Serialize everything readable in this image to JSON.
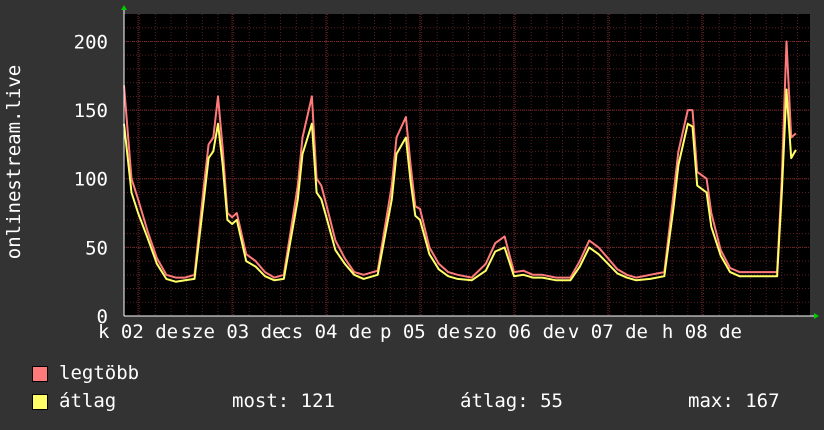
{
  "colors": {
    "background": "#333333",
    "plot_background": "#000000",
    "grid": "#5a2020",
    "grid_major": "#7a2a2a",
    "axis": "#ffffff",
    "arrow": "#00cc00",
    "max_series": "#ff7b7b",
    "avg_series": "#ffff66"
  },
  "chart_data": {
    "type": "line",
    "ylabel": "onlinestream.live",
    "ylim": [
      0,
      220
    ],
    "yticks": [
      "0",
      "50",
      "100",
      "150",
      "200"
    ],
    "ytick_values": [
      0,
      50,
      100,
      150,
      200
    ],
    "x_days": 7.3,
    "xticks": [
      "k 02 de",
      "sze 03 de",
      "cs 04 de",
      "p 05 de",
      "szo 06 de",
      "v 07 de",
      "h 08 de"
    ],
    "xtick_positions": [
      0.15,
      1.15,
      2.15,
      3.15,
      4.15,
      5.15,
      6.15
    ],
    "legend": [
      "legtöbb",
      "átlag"
    ],
    "series": [
      {
        "name": "legtöbb",
        "color": "#ff7b7b",
        "x": [
          0,
          0.08,
          0.15,
          0.25,
          0.35,
          0.45,
          0.55,
          0.65,
          0.75,
          0.85,
          0.9,
          0.95,
          1.0,
          1.05,
          1.1,
          1.15,
          1.2,
          1.3,
          1.4,
          1.5,
          1.6,
          1.7,
          1.85,
          1.9,
          2.0,
          2.05,
          2.1,
          2.15,
          2.25,
          2.35,
          2.45,
          2.55,
          2.7,
          2.85,
          2.9,
          3.0,
          3.05,
          3.1,
          3.15,
          3.25,
          3.35,
          3.45,
          3.55,
          3.7,
          3.85,
          3.95,
          4.05,
          4.15,
          4.25,
          4.35,
          4.45,
          4.6,
          4.75,
          4.85,
          4.95,
          5.05,
          5.15,
          5.25,
          5.35,
          5.45,
          5.6,
          5.75,
          5.85,
          5.9,
          6.0,
          6.05,
          6.1,
          6.2,
          6.25,
          6.35,
          6.45,
          6.55,
          6.75,
          6.95,
          7.0,
          7.05,
          7.1,
          7.15
        ],
        "values": [
          168,
          100,
          85,
          62,
          42,
          30,
          28,
          28,
          30,
          95,
          125,
          130,
          160,
          122,
          75,
          72,
          75,
          45,
          40,
          32,
          28,
          30,
          95,
          130,
          160,
          100,
          95,
          82,
          55,
          42,
          32,
          30,
          33,
          95,
          130,
          145,
          110,
          80,
          78,
          50,
          38,
          32,
          30,
          28,
          38,
          53,
          58,
          32,
          33,
          30,
          30,
          28,
          28,
          40,
          55,
          50,
          42,
          34,
          30,
          28,
          30,
          32,
          90,
          120,
          150,
          150,
          105,
          100,
          75,
          48,
          35,
          32,
          32,
          32,
          100,
          200,
          130,
          133
        ]
      },
      {
        "name": "átlag",
        "color": "#ffff66",
        "x": [
          0,
          0.08,
          0.15,
          0.25,
          0.35,
          0.45,
          0.55,
          0.65,
          0.75,
          0.85,
          0.9,
          0.95,
          1.0,
          1.05,
          1.1,
          1.15,
          1.2,
          1.3,
          1.4,
          1.5,
          1.6,
          1.7,
          1.85,
          1.9,
          2.0,
          2.05,
          2.1,
          2.15,
          2.25,
          2.35,
          2.45,
          2.55,
          2.7,
          2.85,
          2.9,
          3.0,
          3.05,
          3.1,
          3.15,
          3.25,
          3.35,
          3.45,
          3.55,
          3.7,
          3.85,
          3.95,
          4.05,
          4.15,
          4.25,
          4.35,
          4.45,
          4.6,
          4.75,
          4.85,
          4.95,
          5.05,
          5.15,
          5.25,
          5.35,
          5.45,
          5.6,
          5.75,
          5.85,
          5.9,
          6.0,
          6.05,
          6.1,
          6.2,
          6.25,
          6.35,
          6.45,
          6.55,
          6.75,
          6.95,
          7.0,
          7.05,
          7.1,
          7.15
        ],
        "values": [
          140,
          90,
          75,
          57,
          38,
          27,
          25,
          26,
          27,
          85,
          115,
          120,
          140,
          110,
          70,
          67,
          70,
          40,
          36,
          29,
          26,
          27,
          85,
          118,
          140,
          90,
          85,
          73,
          48,
          38,
          30,
          27,
          30,
          85,
          118,
          130,
          98,
          73,
          70,
          45,
          34,
          29,
          27,
          26,
          33,
          47,
          50,
          29,
          30,
          28,
          28,
          26,
          26,
          36,
          50,
          45,
          38,
          31,
          28,
          26,
          27,
          29,
          80,
          110,
          140,
          138,
          95,
          90,
          65,
          44,
          32,
          29,
          29,
          29,
          90,
          165,
          115,
          121
        ]
      }
    ],
    "stats": {
      "now_label": "most:",
      "now_value": "121",
      "avg_label": "átlag:",
      "avg_value": "55",
      "max_label": "max:",
      "max_value": "167"
    }
  }
}
